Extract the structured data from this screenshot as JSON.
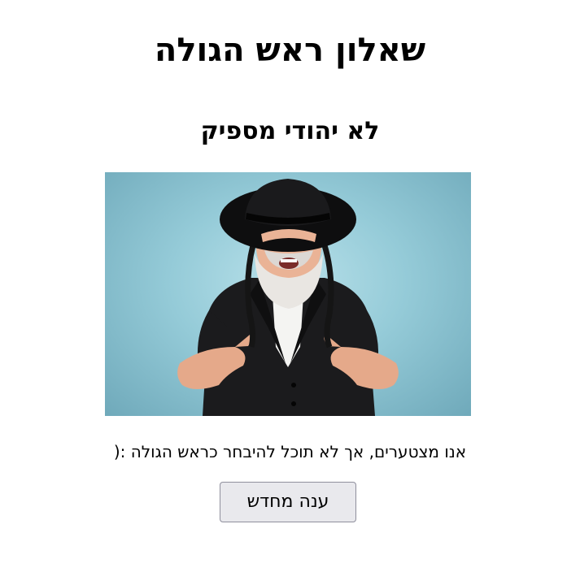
{
  "page": {
    "title": "שאלון ראש הגולה",
    "subtitle": "לא יהודי מספיק",
    "message": "אנו מצטערים, אך לא תוכל להיבחר כראש הגולה :(",
    "retry_label": "ענה מחדש"
  },
  "colors": {
    "background": "#ffffff",
    "photo_background": "#95cbd8",
    "button_background": "#e9e9ed",
    "button_border": "#8f8f9d"
  }
}
